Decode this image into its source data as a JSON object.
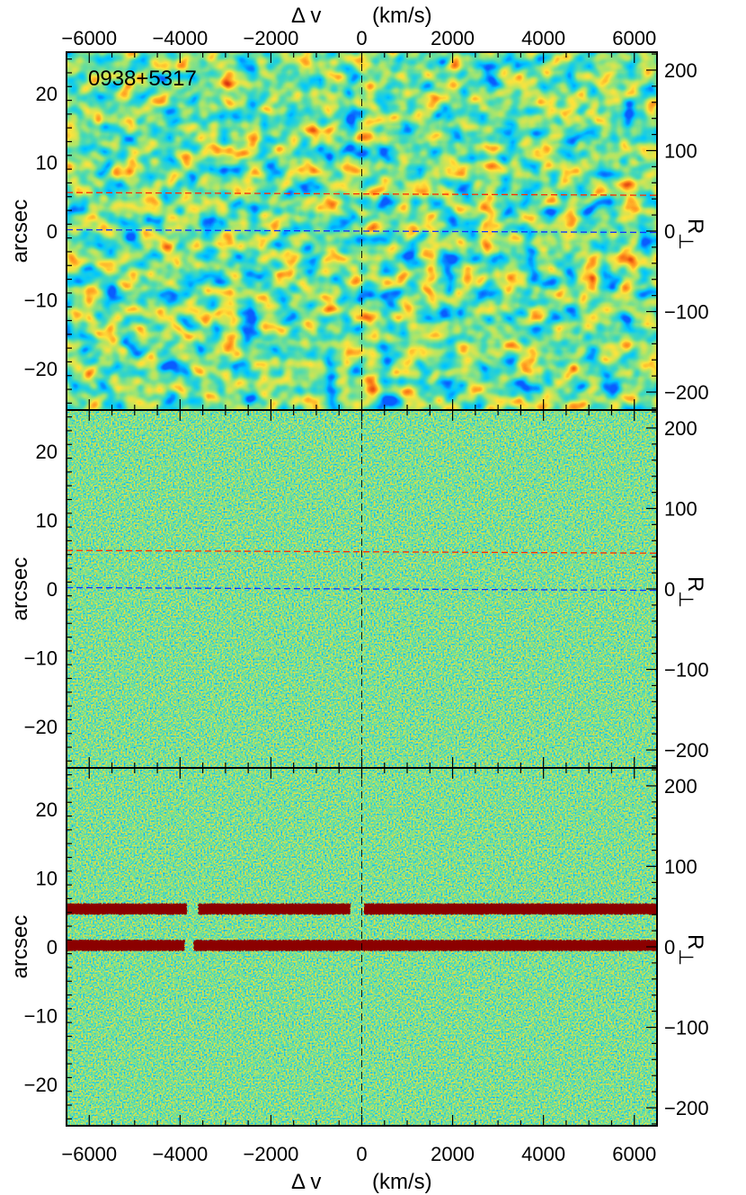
{
  "chart_data": {
    "type": "heatmap",
    "annotation": "0938+5317",
    "x_axis": {
      "label_symbol": "Δ v",
      "label_unit": "(km/s)",
      "range": [
        -6500,
        6500
      ],
      "ticks": [
        -6000,
        -4000,
        -2000,
        0,
        2000,
        4000,
        6000
      ],
      "tick_labels": [
        "−6000",
        "−4000",
        "−2000",
        "0",
        "2000",
        "4000",
        "6000"
      ]
    },
    "y_axis_left": {
      "label": "arcsec",
      "range": [
        -26,
        26
      ],
      "ticks": [
        20,
        10,
        0,
        -10,
        -20
      ],
      "tick_labels": [
        "20",
        "10",
        "0",
        "−10",
        "−20"
      ]
    },
    "y_axis_right": {
      "label": "R",
      "label_subscript": "⊥",
      "ticks": [
        200,
        100,
        0,
        -100,
        -200
      ],
      "tick_labels": [
        "200",
        "100",
        "0",
        "−100",
        "−200"
      ],
      "scale_per_arcsec": 8.55
    },
    "panels": [
      {
        "index": 1,
        "texture": "smoothed"
      },
      {
        "index": 2,
        "texture": "noise"
      },
      {
        "index": 3,
        "texture": "noise",
        "traces": [
          {
            "y_arcsec": 5.5,
            "segments": [
              [
                -6500,
                -3850
              ],
              [
                -3600,
                -250
              ],
              [
                50,
                6500
              ]
            ],
            "thickness_arcsec": 1.6
          },
          {
            "y_arcsec": 0.2,
            "segments": [
              [
                -6500,
                -3900
              ],
              [
                -3700,
                6500
              ]
            ],
            "thickness_arcsec": 1.6
          }
        ]
      }
    ],
    "reference_lines": [
      {
        "orientation": "horizontal",
        "y_start": 5.6,
        "y_end": 5.2,
        "color": "#ff2a00",
        "panels": [
          1,
          2
        ],
        "style": "dashed"
      },
      {
        "orientation": "horizontal",
        "y_start": 0.2,
        "y_end": -0.2,
        "color": "#1030ff",
        "panels": [
          1,
          2
        ],
        "style": "dashed"
      },
      {
        "orientation": "vertical",
        "x": 0,
        "color": "#000000",
        "panels": [
          1,
          2,
          3
        ],
        "style": "dashed"
      }
    ],
    "colormap": [
      "#0a5cff",
      "#00c8ff",
      "#45d8b8",
      "#a8e56a",
      "#ffe23a",
      "#ff8a1c",
      "#d4240d",
      "#8b0000"
    ]
  }
}
